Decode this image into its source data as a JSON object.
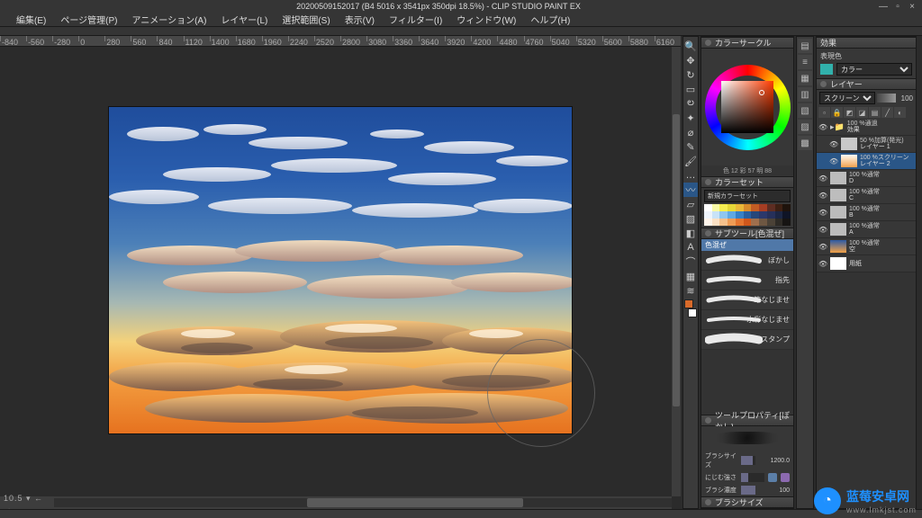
{
  "title": "20200509152017 (B4 5016 x 3541px 350dpi 18.5%) - CLIP STUDIO PAINT EX",
  "menu": [
    "編集(E)",
    "ページ管理(P)",
    "アニメーション(A)",
    "レイヤー(L)",
    "選択範囲(S)",
    "表示(V)",
    "フィルター(I)",
    "ウィンドウ(W)",
    "ヘルプ(H)"
  ],
  "ruler_marks": [
    -840,
    -560,
    -280,
    0,
    280,
    560,
    840,
    1120,
    1400,
    1680,
    1960,
    2240,
    2520,
    2800,
    3080,
    3360,
    3640,
    3920,
    4200,
    4480,
    4760,
    5040,
    5320,
    5600,
    5880,
    6160
  ],
  "status_left": "10.5 ▾ ← →",
  "tools": [
    {
      "name": "zoom-icon",
      "glyph": "🔍"
    },
    {
      "name": "move-icon",
      "glyph": "✥"
    },
    {
      "name": "rotate-icon",
      "glyph": "↻"
    },
    {
      "name": "select-rect-icon",
      "glyph": "▭"
    },
    {
      "name": "lasso-icon",
      "glyph": "ల"
    },
    {
      "name": "wand-icon",
      "glyph": "✦"
    },
    {
      "name": "eyedropper-icon",
      "glyph": "⌀"
    },
    {
      "name": "pen-icon",
      "glyph": "✎"
    },
    {
      "name": "brush-icon",
      "glyph": "🖌"
    },
    {
      "name": "airbrush-icon",
      "glyph": "…"
    },
    {
      "name": "blend-icon",
      "glyph": "〰",
      "active": true
    },
    {
      "name": "eraser-icon",
      "glyph": "▱"
    },
    {
      "name": "fill-icon",
      "glyph": "▨"
    },
    {
      "name": "gradient-icon",
      "glyph": "◧"
    },
    {
      "name": "text-icon",
      "glyph": "A"
    },
    {
      "name": "ruler-icon",
      "glyph": "⌒"
    },
    {
      "name": "frame-icon",
      "glyph": "▦"
    },
    {
      "name": "correction-icon",
      "glyph": "≋"
    }
  ],
  "color": {
    "panel": "カラーサークル",
    "readout": "色 12 彩 57 明 88"
  },
  "color_set": {
    "panel": "カラーセット",
    "dropdown": "新規カラーセット",
    "row1": [
      "#ffffff",
      "#f9faa6",
      "#f6ee50",
      "#e6d737",
      "#eab838",
      "#d88b2b",
      "#c35c23",
      "#a63d23",
      "#5e2d22",
      "#3d2013",
      "#1e130c"
    ],
    "row2": [
      "#eef4fb",
      "#c9e3f7",
      "#8fc6ef",
      "#5fa8e3",
      "#3580c6",
      "#285fa0",
      "#26477a",
      "#2b386b",
      "#26305a",
      "#1c2644",
      "#0f1426"
    ],
    "row3": [
      "#fef4ea",
      "#fbe1c5",
      "#f6c18c",
      "#ef9c55",
      "#e5752f",
      "#d0571b",
      "#9f6f4d",
      "#6e5742",
      "#4b4237",
      "#2e2b26",
      "#161413"
    ]
  },
  "subtool": {
    "panel": "サブツール[色混ぜ]",
    "group": "色混ぜ",
    "items": [
      "ぼかし",
      "指先",
      "筆なじませ",
      "水彩なじませ",
      "コピースタンプ"
    ]
  },
  "tool_property": {
    "panel": "ツールプロパティ[ぼかし]",
    "rows": [
      {
        "label": "ブラシサイズ",
        "value": "1200.0"
      },
      {
        "label": "にじむ強さ",
        "value": ""
      },
      {
        "label": "ブラシ濃度",
        "value": "100"
      }
    ]
  },
  "brush_size_panel": "ブラシサイズ",
  "effect": {
    "panel": "効果",
    "expr_label": "表現色",
    "expr_value": "カラー"
  },
  "layers": {
    "panel": "レイヤー",
    "blend_mode": "スクリーン",
    "opacity": "100",
    "group": {
      "info": "100 %通過",
      "name": "効果"
    },
    "items": [
      {
        "info": "50 %加算(発光)",
        "name": "レイヤー 1",
        "thumb": "#c9c9c9"
      },
      {
        "info": "100 %スクリーン",
        "name": "レイヤー 2",
        "thumb": "linear-gradient(#fefcf6,#f2a14e)",
        "selected": true
      },
      {
        "info": "100 %通常",
        "name": "D",
        "thumb": "#bcbcbc"
      },
      {
        "info": "100 %通常",
        "name": "C",
        "thumb": "#bdbdbd"
      },
      {
        "info": "100 %通常",
        "name": "B",
        "thumb": "#bcbcbc"
      },
      {
        "info": "100 %通常",
        "name": "A",
        "thumb": "#bcbcbc"
      },
      {
        "info": "100 %通常",
        "name": "空",
        "thumb": "linear-gradient(#2d5aa4,#f3a247)"
      },
      {
        "info": "",
        "name": "用紙",
        "thumb": "#ffffff"
      }
    ]
  },
  "watermark": {
    "cn": "蓝莓安卓网",
    "url": "www.lmkjst.com"
  }
}
